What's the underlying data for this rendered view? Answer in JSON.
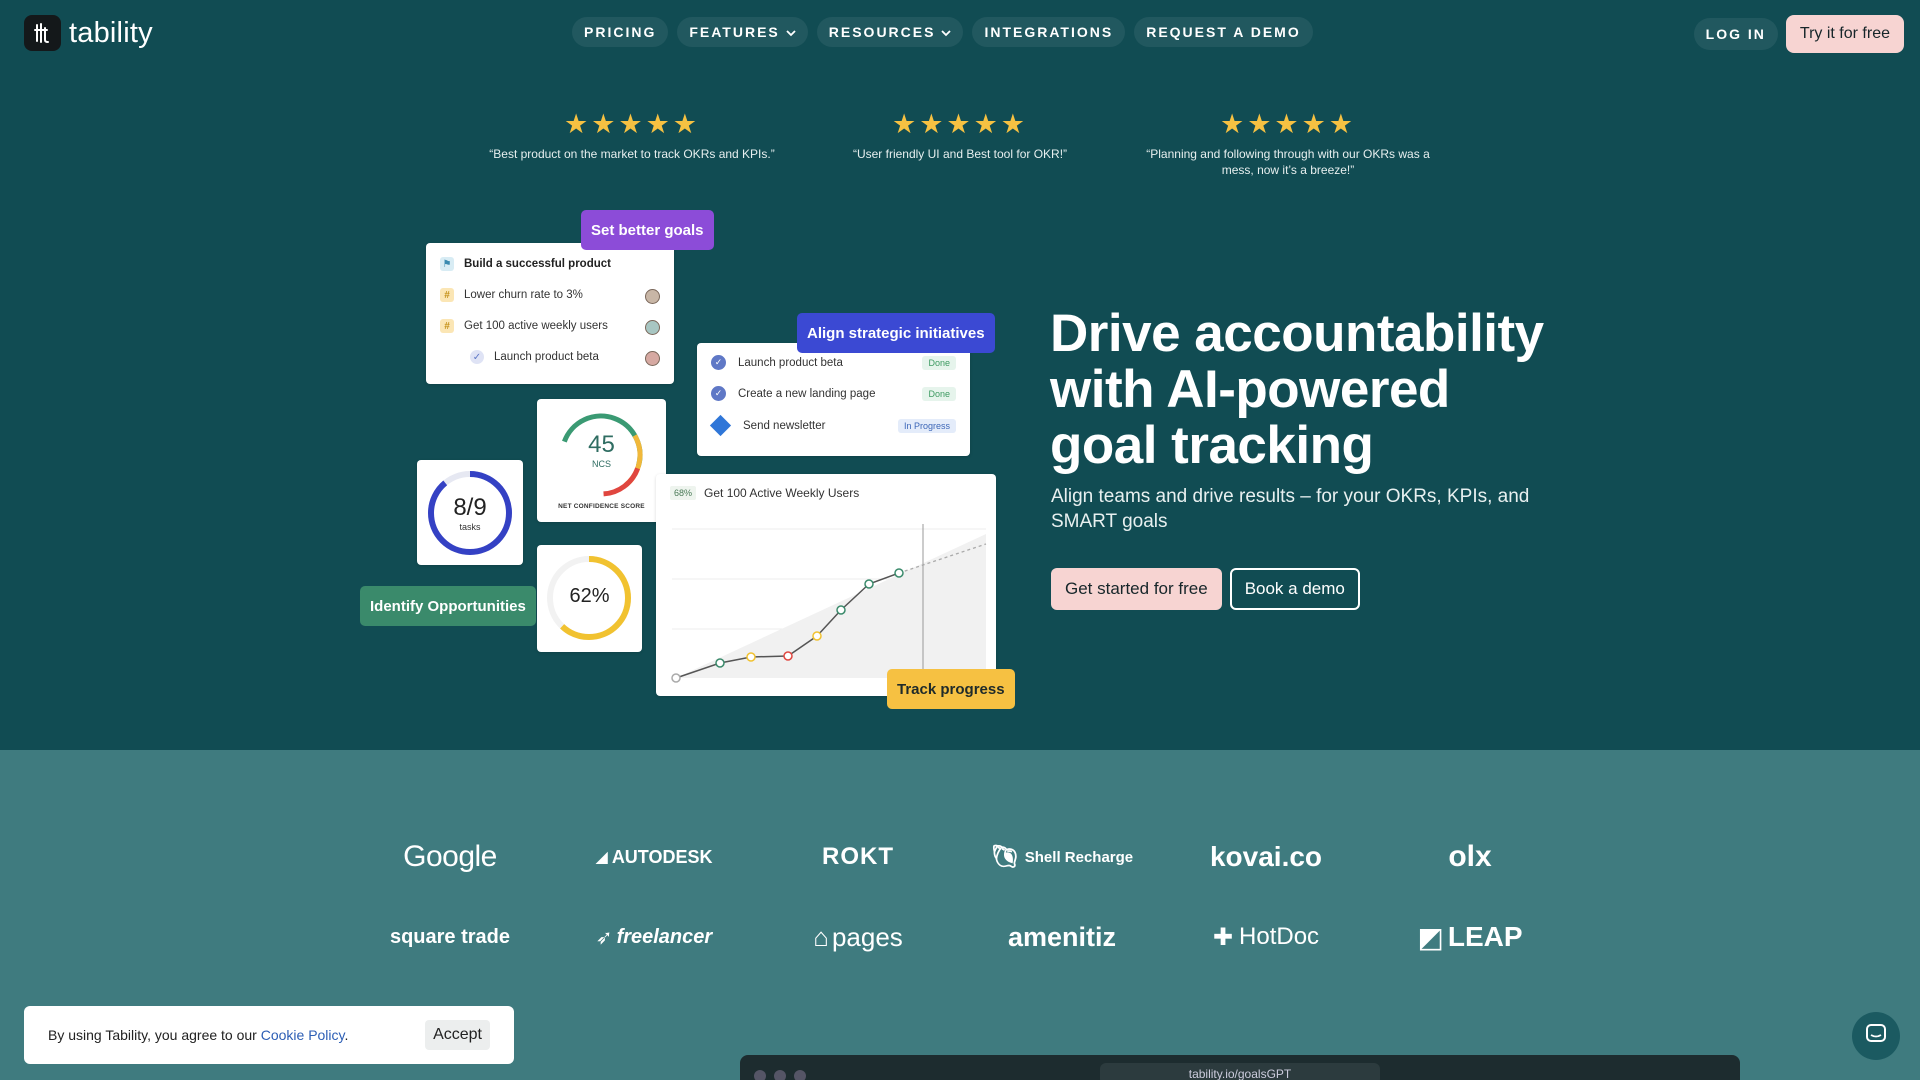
{
  "nav": {
    "brand": "tability",
    "links": [
      {
        "label": "PRICING",
        "dropdown": false
      },
      {
        "label": "FEATURES",
        "dropdown": true
      },
      {
        "label": "RESOURCES",
        "dropdown": true
      },
      {
        "label": "INTEGRATIONS",
        "dropdown": false
      },
      {
        "label": "REQUEST A DEMO",
        "dropdown": false
      }
    ],
    "login": "LOG IN",
    "try": "Try it for free"
  },
  "reviews": [
    {
      "stars": 5,
      "quote": "“Best product on the market to track OKRs and KPIs.”"
    },
    {
      "stars": 5,
      "quote": "“User friendly UI and Best tool for OKR!”"
    },
    {
      "stars": 5,
      "quote": "“Planning and following through with our OKRs was a mess, now it’s a breeze!”"
    }
  ],
  "illustration": {
    "tag_goals": "Set better goals",
    "goals": [
      {
        "label": "Build a successful product",
        "icon": "flag"
      },
      {
        "label": "Lower churn rate to 3%",
        "icon": "hash"
      },
      {
        "label": "Get 100 active weekly users",
        "icon": "hash"
      },
      {
        "label": "Launch product beta",
        "icon": "check"
      }
    ],
    "tag_align": "Align strategic initiatives",
    "initiatives": [
      {
        "label": "Launch product beta",
        "status": "Done"
      },
      {
        "label": "Create a new landing page",
        "status": "Done"
      },
      {
        "label": "Send newsletter",
        "status": "In Progress"
      }
    ],
    "ncs": {
      "value": "45",
      "unit": "NCS",
      "caption": "NET CONFIDENCE SCORE"
    },
    "tasks": {
      "value": "8/9",
      "unit": "tasks",
      "fraction": 0.889
    },
    "percent": {
      "value": "62%",
      "fraction": 0.62
    },
    "tag_identify": "Identify Opportunities",
    "chart": {
      "badge": "68%",
      "title": "Get 100 Active Weekly Users"
    },
    "tag_track": "Track progress"
  },
  "hero": {
    "headline": "Drive accountability with AI-powered goal tracking",
    "subline": "Align teams and drive results – for your OKRs, KPIs, and SMART goals",
    "cta_primary": "Get started for free",
    "cta_secondary": "Book a demo"
  },
  "logos": [
    "Google",
    "AUTODESK",
    "ROKT",
    "Shell Recharge",
    "kovai.co",
    "olx",
    "square trade",
    "freelancer",
    "pages",
    "amenitiz",
    "HotDoc",
    "LEAP"
  ],
  "cookie": {
    "text": "By using Tability, you agree to our ",
    "link": "Cookie Policy",
    "period": ".",
    "accept": "Accept"
  },
  "browser": {
    "url": "tability.io/goalsGPT"
  },
  "colors": {
    "bg": "#114c53",
    "logos_bg": "#3f7b7f",
    "pink": "#f7d4d2",
    "purple": "#8c4cd8",
    "blue": "#3b49d3",
    "green": "#3a8a6b",
    "yellow": "#f6c142"
  }
}
